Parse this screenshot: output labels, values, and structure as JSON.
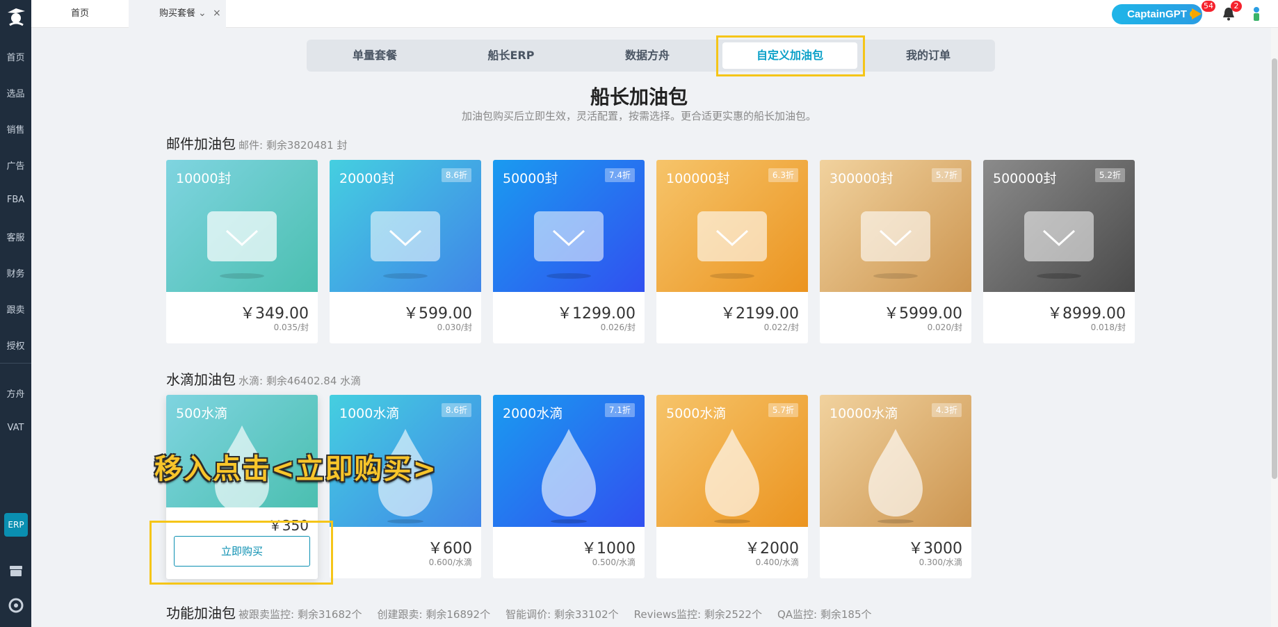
{
  "sidebar": {
    "items": [
      {
        "label": "首页"
      },
      {
        "label": "选品"
      },
      {
        "label": "销售"
      },
      {
        "label": "广告"
      },
      {
        "label": "FBA"
      },
      {
        "label": "客服"
      },
      {
        "label": "财务"
      },
      {
        "label": "跟卖"
      },
      {
        "label": "授权"
      },
      {
        "label": "方舟"
      },
      {
        "label": "VAT"
      }
    ],
    "erp_label": "ERP"
  },
  "topbar": {
    "tabs": [
      {
        "label": "首页"
      },
      {
        "label": "购买套餐"
      }
    ],
    "captain_label": "CaptainGPT",
    "flag_count": "54",
    "bell_count": "2"
  },
  "segmented": {
    "tabs": [
      {
        "label": "单量套餐"
      },
      {
        "label": "船长ERP"
      },
      {
        "label": "数据方舟"
      },
      {
        "label": "自定义加油包"
      },
      {
        "label": "我的订单"
      }
    ],
    "active": "自定义加油包"
  },
  "page": {
    "title": "船长加油包",
    "subtitle": "加油包购买后立即生效，灵活配置，按需选择。更合适更实惠的船长加油包。"
  },
  "mail_section": {
    "title": "邮件加油包",
    "note": "邮件: 剩余3820481 封",
    "cards": [
      {
        "name": "10000封",
        "discount": "",
        "price": "￥349.00",
        "unit": "0.035/封"
      },
      {
        "name": "20000封",
        "discount": "8.6折",
        "price": "￥599.00",
        "unit": "0.030/封"
      },
      {
        "name": "50000封",
        "discount": "7.4折",
        "price": "￥1299.00",
        "unit": "0.026/封"
      },
      {
        "name": "100000封",
        "discount": "6.3折",
        "price": "￥2199.00",
        "unit": "0.022/封"
      },
      {
        "name": "300000封",
        "discount": "5.7折",
        "price": "￥5999.00",
        "unit": "0.020/封"
      },
      {
        "name": "500000封",
        "discount": "5.2折",
        "price": "￥8999.00",
        "unit": "0.018/封"
      }
    ]
  },
  "drop_section": {
    "title": "水滴加油包",
    "note": "水滴: 剩余46402.84 水滴",
    "cards": [
      {
        "name": "500水滴",
        "discount": "",
        "price": "￥350",
        "unit": ""
      },
      {
        "name": "1000水滴",
        "discount": "8.6折",
        "price": "￥600",
        "unit": "0.600/水滴"
      },
      {
        "name": "2000水滴",
        "discount": "7.1折",
        "price": "￥1000",
        "unit": "0.500/水滴"
      },
      {
        "name": "5000水滴",
        "discount": "5.7折",
        "price": "￥2000",
        "unit": "0.400/水滴"
      },
      {
        "name": "10000水滴",
        "discount": "4.3折",
        "price": "￥3000",
        "unit": "0.300/水滴"
      }
    ],
    "buy_label": "立即购买"
  },
  "overlay_caption": "移入点击<立即购买>",
  "func_section": {
    "title": "功能加油包",
    "notes": [
      "被跟卖监控: 剩余31682个",
      "创建跟卖: 剩余16892个",
      "智能调价: 剩余33102个",
      "Reviews监控: 剩余2522个",
      "QA监控: 剩余185个"
    ]
  },
  "colors": {
    "sidebar_bg": "#1f2d3d",
    "accent": "#0a8fb1",
    "highlight": "#f5c518",
    "badge": "#f5222d"
  }
}
